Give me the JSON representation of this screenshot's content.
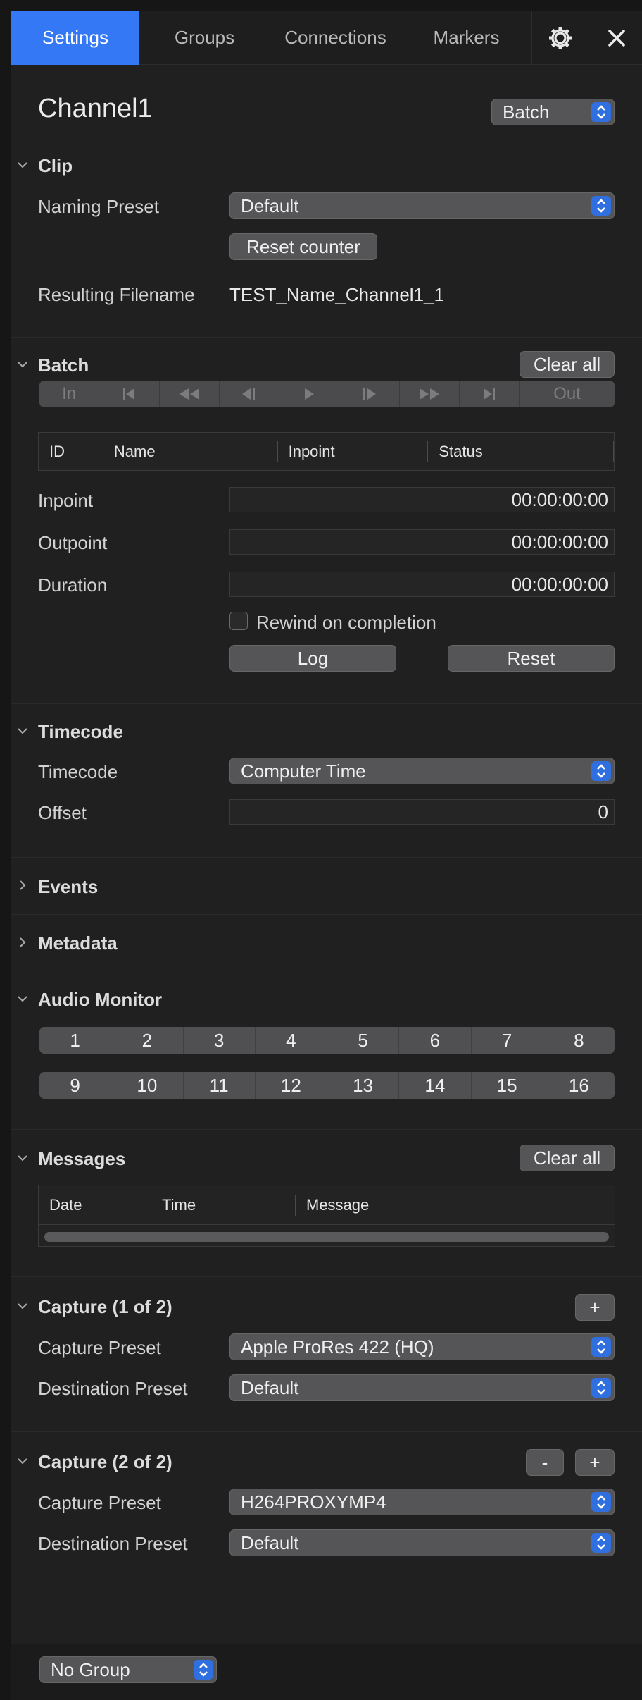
{
  "tabs": [
    "Settings",
    "Groups",
    "Connections",
    "Markers"
  ],
  "channel": {
    "title": "Channel1",
    "mode_select": "Batch"
  },
  "clip": {
    "header": "Clip",
    "naming_preset_label": "Naming Preset",
    "naming_preset_value": "Default",
    "reset_counter": "Reset counter",
    "resulting_filename_label": "Resulting Filename",
    "resulting_filename_value": "TEST_Name_Channel1_1"
  },
  "batch": {
    "header": "Batch",
    "clear_all": "Clear all",
    "transport": [
      "In",
      "⏮",
      "⏪",
      "◀▏",
      "▶",
      "▕▶",
      "⏩",
      "⏭",
      "Out"
    ],
    "columns": [
      "ID",
      "Name",
      "Inpoint",
      "Status"
    ],
    "inpoint_label": "Inpoint",
    "inpoint_value": "00:00:00:00",
    "outpoint_label": "Outpoint",
    "outpoint_value": "00:00:00:00",
    "duration_label": "Duration",
    "duration_value": "00:00:00:00",
    "rewind_label": "Rewind on completion",
    "log": "Log",
    "reset": "Reset"
  },
  "timecode": {
    "header": "Timecode",
    "timecode_label": "Timecode",
    "timecode_value": "Computer Time",
    "offset_label": "Offset",
    "offset_value": "0"
  },
  "events": {
    "header": "Events"
  },
  "metadata": {
    "header": "Metadata"
  },
  "audio_monitor": {
    "header": "Audio Monitor",
    "row1": [
      "1",
      "2",
      "3",
      "4",
      "5",
      "6",
      "7",
      "8"
    ],
    "row2": [
      "9",
      "10",
      "11",
      "12",
      "13",
      "14",
      "15",
      "16"
    ]
  },
  "messages": {
    "header": "Messages",
    "clear_all": "Clear all",
    "columns": [
      "Date",
      "Time",
      "Message"
    ]
  },
  "capture1": {
    "header": "Capture (1 of 2)",
    "add": "+",
    "capture_preset_label": "Capture Preset",
    "capture_preset_value": "Apple ProRes 422 (HQ)",
    "destination_preset_label": "Destination Preset",
    "destination_preset_value": "Default"
  },
  "capture2": {
    "header": "Capture (2 of 2)",
    "remove": "-",
    "add": "+",
    "capture_preset_label": "Capture Preset",
    "capture_preset_value": "H264PROXYMP4",
    "destination_preset_label": "Destination Preset",
    "destination_preset_value": "Default"
  },
  "footer": {
    "group_select": "No Group"
  },
  "colors": {
    "accent": "#3478f6",
    "background": "#202021",
    "control": "#555557"
  }
}
